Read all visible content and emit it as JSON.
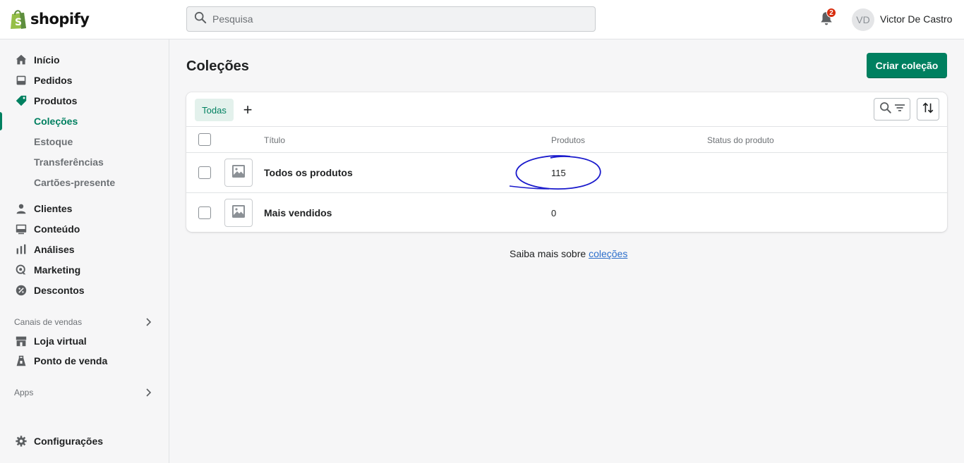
{
  "brand": {
    "name": "shopify",
    "accent": "#008060"
  },
  "search": {
    "placeholder": "Pesquisa"
  },
  "header": {
    "notification_count": "2",
    "user_initials": "VD",
    "user_name": "Victor De Castro"
  },
  "sidebar": {
    "items": [
      {
        "label": "Início",
        "icon": "home-icon"
      },
      {
        "label": "Pedidos",
        "icon": "orders-icon"
      },
      {
        "label": "Produtos",
        "icon": "tag-icon"
      },
      {
        "label": "Clientes",
        "icon": "person-icon"
      },
      {
        "label": "Conteúdo",
        "icon": "content-icon"
      },
      {
        "label": "Análises",
        "icon": "analytics-icon"
      },
      {
        "label": "Marketing",
        "icon": "marketing-icon"
      },
      {
        "label": "Descontos",
        "icon": "discount-icon"
      }
    ],
    "product_subitems": [
      "Coleções",
      "Estoque",
      "Transferências",
      "Cartões-presente"
    ],
    "active_subitem": "Coleções",
    "sales_channels_title": "Canais de vendas",
    "sales_channels": [
      {
        "label": "Loja virtual",
        "icon": "store-icon"
      },
      {
        "label": "Ponto de venda",
        "icon": "pos-icon"
      }
    ],
    "apps_title": "Apps",
    "settings_label": "Configurações"
  },
  "page": {
    "title": "Coleções",
    "primary_action": "Criar coleção"
  },
  "table": {
    "tabs": [
      {
        "label": "Todas",
        "active": true
      }
    ],
    "add_tab": "+",
    "columns": [
      "Título",
      "Produtos",
      "Status do produto"
    ],
    "rows": [
      {
        "title": "Todos os produtos",
        "products": "115",
        "status": ""
      },
      {
        "title": "Mais vendidos",
        "products": "0",
        "status": ""
      }
    ]
  },
  "footer_help": {
    "text": "Saiba mais sobre ",
    "link": "coleções"
  },
  "annotation": {
    "shape": "hand-drawn ellipse around product count",
    "color": "#1a1acc"
  }
}
